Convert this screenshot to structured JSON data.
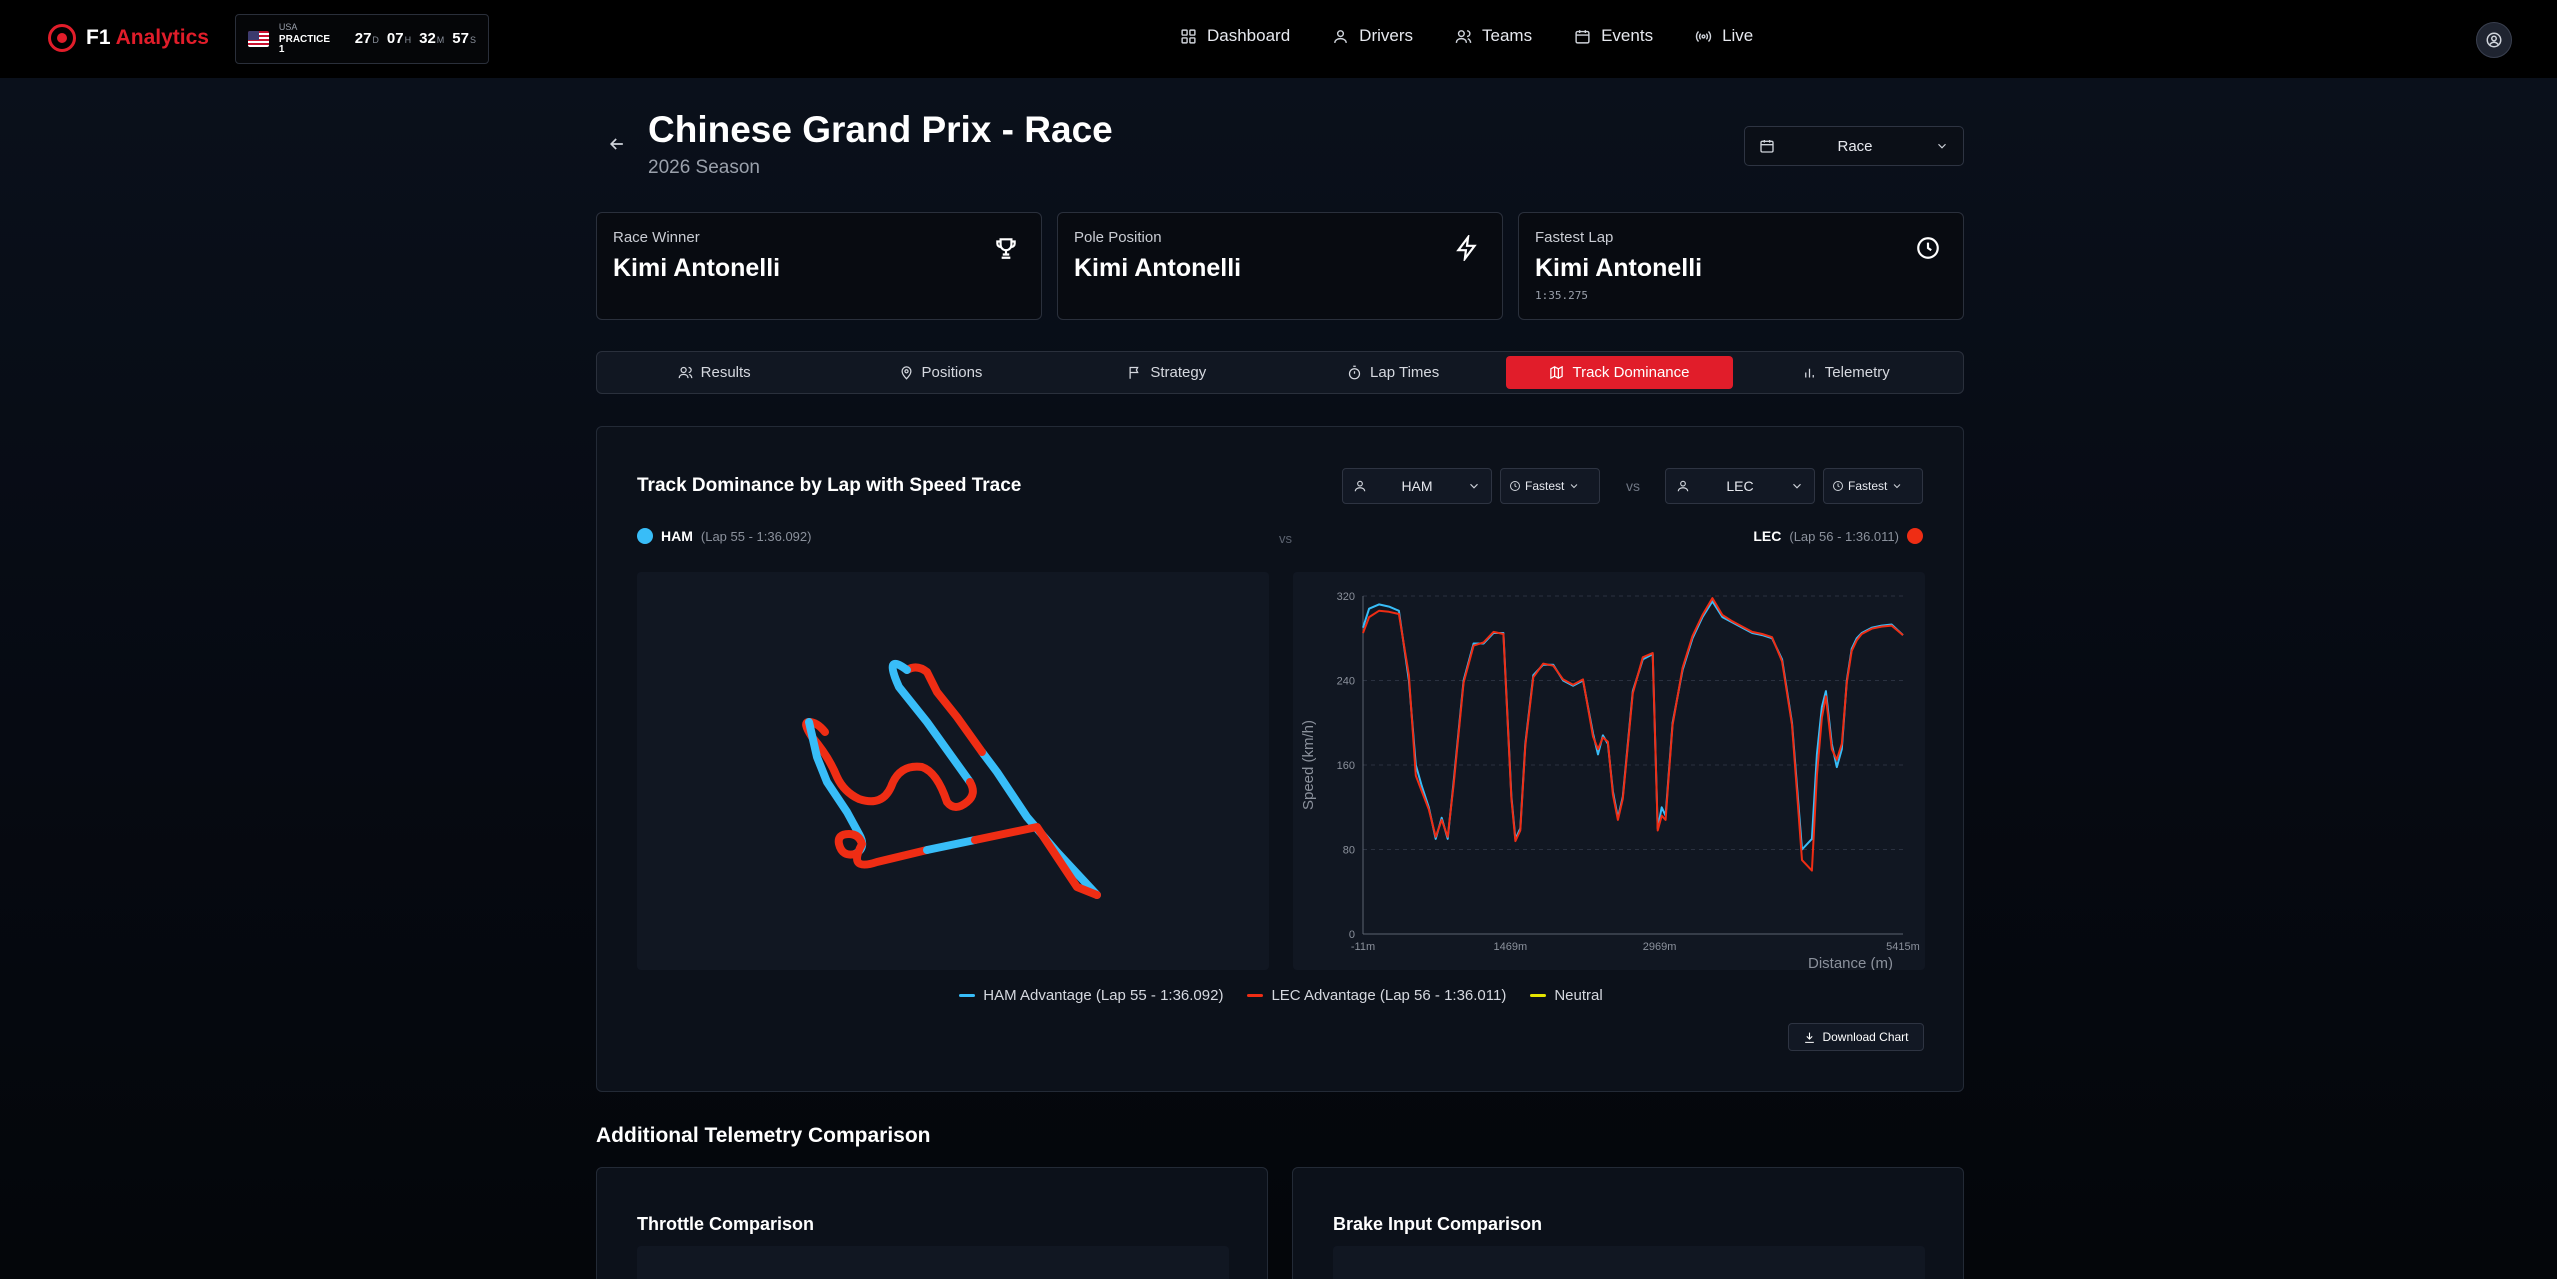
{
  "brand": {
    "prefix": "F1",
    "name": "Analytics"
  },
  "session_badge": {
    "country": "USA",
    "session": "PRACTICE 1",
    "countdown": [
      {
        "value": "27",
        "unit": "D"
      },
      {
        "value": "07",
        "unit": "H"
      },
      {
        "value": "32",
        "unit": "M"
      },
      {
        "value": "57",
        "unit": "S"
      }
    ]
  },
  "nav": {
    "items": [
      {
        "label": "Dashboard",
        "icon": "grid-icon"
      },
      {
        "label": "Drivers",
        "icon": "user-icon"
      },
      {
        "label": "Teams",
        "icon": "users-icon"
      },
      {
        "label": "Events",
        "icon": "calendar-icon"
      },
      {
        "label": "Live",
        "icon": "broadcast-icon"
      }
    ]
  },
  "header": {
    "title": "Chinese Grand Prix - Race",
    "subtitle": "2026 Season",
    "session_select": "Race"
  },
  "stats": [
    {
      "label": "Race Winner",
      "value": "Kimi Antonelli",
      "sub": "",
      "icon": "trophy-icon"
    },
    {
      "label": "Pole Position",
      "value": "Kimi Antonelli",
      "sub": "",
      "icon": "lightning-icon"
    },
    {
      "label": "Fastest Lap",
      "value": "Kimi Antonelli",
      "sub": "1:35.275",
      "icon": "clock-icon"
    }
  ],
  "tabs": [
    {
      "label": "Results",
      "icon": "users-icon",
      "active": false
    },
    {
      "label": "Positions",
      "icon": "pin-icon",
      "active": false
    },
    {
      "label": "Strategy",
      "icon": "flag-icon",
      "active": false
    },
    {
      "label": "Lap Times",
      "icon": "stopwatch-icon",
      "active": false
    },
    {
      "label": "Track Dominance",
      "icon": "map-icon",
      "active": true
    },
    {
      "label": "Telemetry",
      "icon": "bar-chart-icon",
      "active": false
    }
  ],
  "panel": {
    "title": "Track Dominance by Lap with Speed Trace",
    "driver1": {
      "code": "HAM",
      "lap_select": "Fastest",
      "lap_info": "(Lap 55 - 1:36.092)",
      "color": "#38bdf8"
    },
    "driver2": {
      "code": "LEC",
      "lap_select": "Fastest",
      "lap_info": "(Lap 56 - 1:36.011)",
      "color": "#ef2d14"
    },
    "vs": "vs",
    "legend": [
      {
        "label": "HAM Advantage (Lap 55 - 1:36.092)",
        "color": "#38bdf8"
      },
      {
        "label": "LEC Advantage (Lap 56 - 1:36.011)",
        "color": "#ef2d14"
      },
      {
        "label": "Neutral",
        "color": "#e5e500"
      }
    ],
    "download_label": "Download Chart"
  },
  "chart_data": {
    "type": "line",
    "xlabel": "Distance (m)",
    "ylabel": "Speed (km/h)",
    "xlim": [
      -11,
      5415
    ],
    "ylim": [
      0,
      320
    ],
    "x_ticks": [
      "-11m",
      "1469m",
      "2969m",
      "5415m"
    ],
    "y_ticks": [
      0,
      80,
      160,
      240,
      320
    ],
    "grid": true,
    "series": [
      {
        "name": "HAM",
        "color": "#38bdf8",
        "x": [
          -11,
          50,
          150,
          250,
          350,
          450,
          520,
          580,
          650,
          720,
          780,
          840,
          900,
          1000,
          1100,
          1200,
          1300,
          1400,
          1480,
          1520,
          1570,
          1620,
          1700,
          1800,
          1900,
          2000,
          2100,
          2200,
          2300,
          2350,
          2400,
          2450,
          2500,
          2550,
          2600,
          2700,
          2800,
          2900,
          2950,
          2990,
          3030,
          3060,
          3100,
          3200,
          3300,
          3400,
          3500,
          3600,
          3700,
          3800,
          3900,
          4000,
          4100,
          4200,
          4300,
          4400,
          4500,
          4550,
          4600,
          4640,
          4700,
          4750,
          4800,
          4850,
          4900,
          4950,
          5000,
          5100,
          5200,
          5300,
          5415
        ],
        "y": [
          290,
          308,
          312,
          310,
          306,
          240,
          160,
          140,
          120,
          90,
          110,
          90,
          145,
          240,
          275,
          275,
          285,
          285,
          130,
          90,
          100,
          180,
          245,
          255,
          255,
          240,
          235,
          240,
          190,
          170,
          188,
          180,
          135,
          110,
          130,
          230,
          260,
          265,
          100,
          120,
          112,
          150,
          200,
          250,
          280,
          300,
          315,
          300,
          295,
          290,
          285,
          283,
          280,
          260,
          200,
          80,
          90,
          170,
          215,
          230,
          180,
          158,
          175,
          240,
          270,
          280,
          285,
          290,
          292,
          293,
          283
        ]
      },
      {
        "name": "LEC",
        "color": "#ef2d14",
        "x": [
          -11,
          50,
          150,
          250,
          350,
          450,
          520,
          580,
          650,
          720,
          780,
          840,
          900,
          1000,
          1100,
          1200,
          1300,
          1400,
          1480,
          1520,
          1570,
          1620,
          1700,
          1800,
          1900,
          2000,
          2100,
          2200,
          2300,
          2350,
          2400,
          2450,
          2500,
          2550,
          2600,
          2700,
          2800,
          2900,
          2950,
          2990,
          3030,
          3060,
          3100,
          3200,
          3300,
          3400,
          3500,
          3600,
          3700,
          3800,
          3900,
          4000,
          4100,
          4200,
          4300,
          4400,
          4500,
          4550,
          4600,
          4640,
          4700,
          4750,
          4800,
          4850,
          4900,
          4950,
          5000,
          5100,
          5200,
          5300,
          5415
        ],
        "y": [
          285,
          300,
          306,
          305,
          303,
          245,
          150,
          135,
          118,
          92,
          108,
          92,
          142,
          238,
          273,
          276,
          286,
          284,
          128,
          88,
          98,
          178,
          243,
          256,
          254,
          241,
          236,
          241,
          187,
          175,
          186,
          182,
          132,
          108,
          128,
          228,
          262,
          266,
          98,
          112,
          108,
          148,
          198,
          252,
          282,
          302,
          318,
          302,
          296,
          291,
          286,
          284,
          281,
          258,
          198,
          70,
          60,
          150,
          205,
          225,
          175,
          165,
          180,
          238,
          268,
          278,
          284,
          289,
          291,
          292,
          283
        ]
      }
    ]
  },
  "additional": {
    "title": "Additional Telemetry Comparison",
    "cards": [
      {
        "title": "Throttle Comparison"
      },
      {
        "title": "Brake Input Comparison"
      }
    ]
  }
}
